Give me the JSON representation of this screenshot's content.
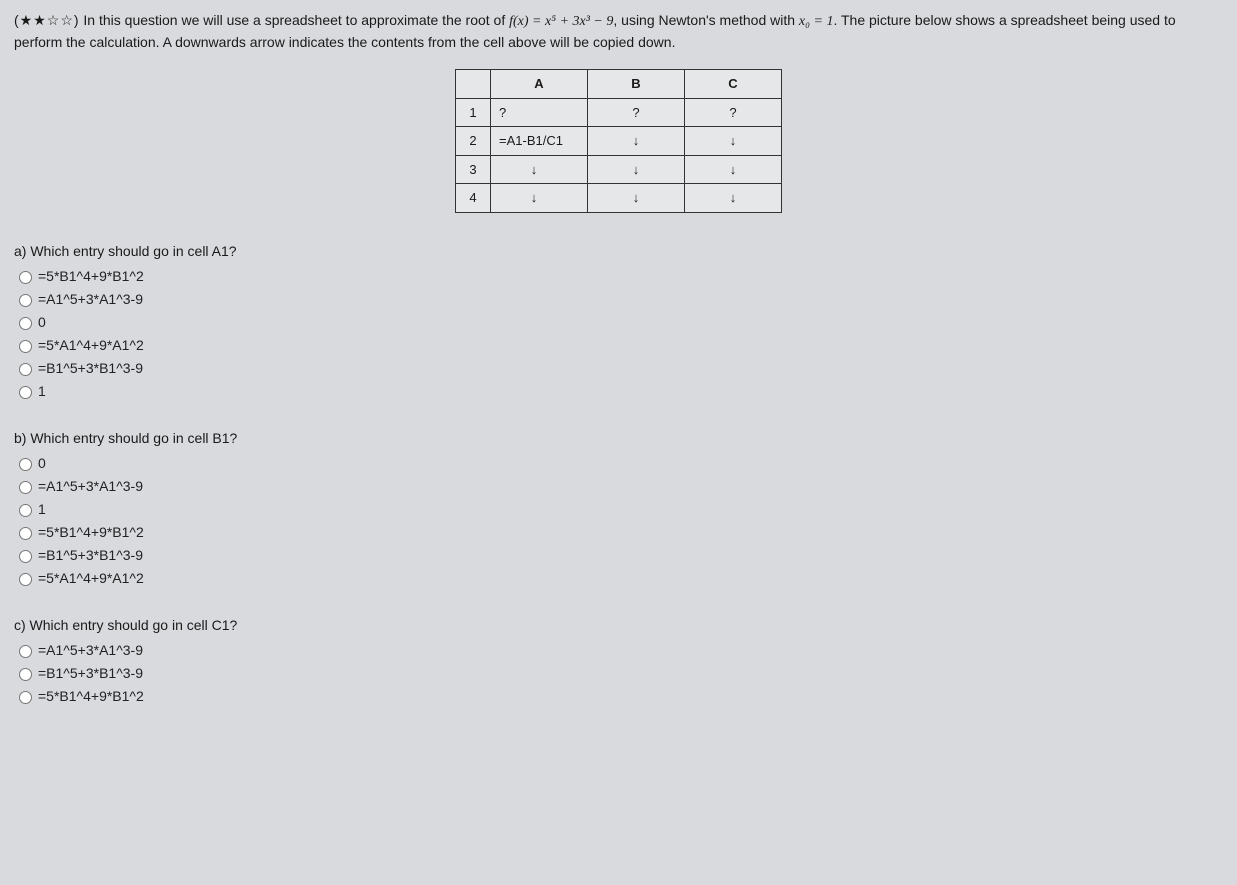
{
  "intro": {
    "stars": "(★★☆☆)",
    "t1": " In this question we will use a spreadsheet to approximate the root of ",
    "f": "f(x) = x⁵ + 3x³ − 9",
    "t2": ", using Newton's method with ",
    "x0": "x₀ = 1",
    "t3": ". The picture below shows a spreadsheet being used to perform the calculation. A downwards arrow indicates the contents from the cell above will be copied down."
  },
  "table": {
    "headA": "A",
    "headB": "B",
    "headC": "C",
    "row1": {
      "n": "1",
      "A": "?",
      "B": "?",
      "C": "?"
    },
    "row2": {
      "n": "2",
      "A": "=A1-B1/C1",
      "B": "↓",
      "C": "↓"
    },
    "row3": {
      "n": "3",
      "A": "↓",
      "B": "↓",
      "C": "↓"
    },
    "row4": {
      "n": "4",
      "A": "↓",
      "B": "↓",
      "C": "↓"
    }
  },
  "parts": {
    "a": {
      "label": "a) Which entry should go in cell A1?",
      "opts": [
        "=5*B1^4+9*B1^2",
        "=A1^5+3*A1^3-9",
        "0",
        "=5*A1^4+9*A1^2",
        "=B1^5+3*B1^3-9",
        "1"
      ]
    },
    "b": {
      "label": "b) Which entry should go in cell B1?",
      "opts": [
        "0",
        "=A1^5+3*A1^3-9",
        "1",
        "=5*B1^4+9*B1^2",
        "=B1^5+3*B1^3-9",
        "=5*A1^4+9*A1^2"
      ]
    },
    "c": {
      "label": "c) Which entry should go in cell C1?",
      "opts": [
        "=A1^5+3*A1^3-9",
        "=B1^5+3*B1^3-9",
        "=5*B1^4+9*B1^2"
      ]
    }
  }
}
